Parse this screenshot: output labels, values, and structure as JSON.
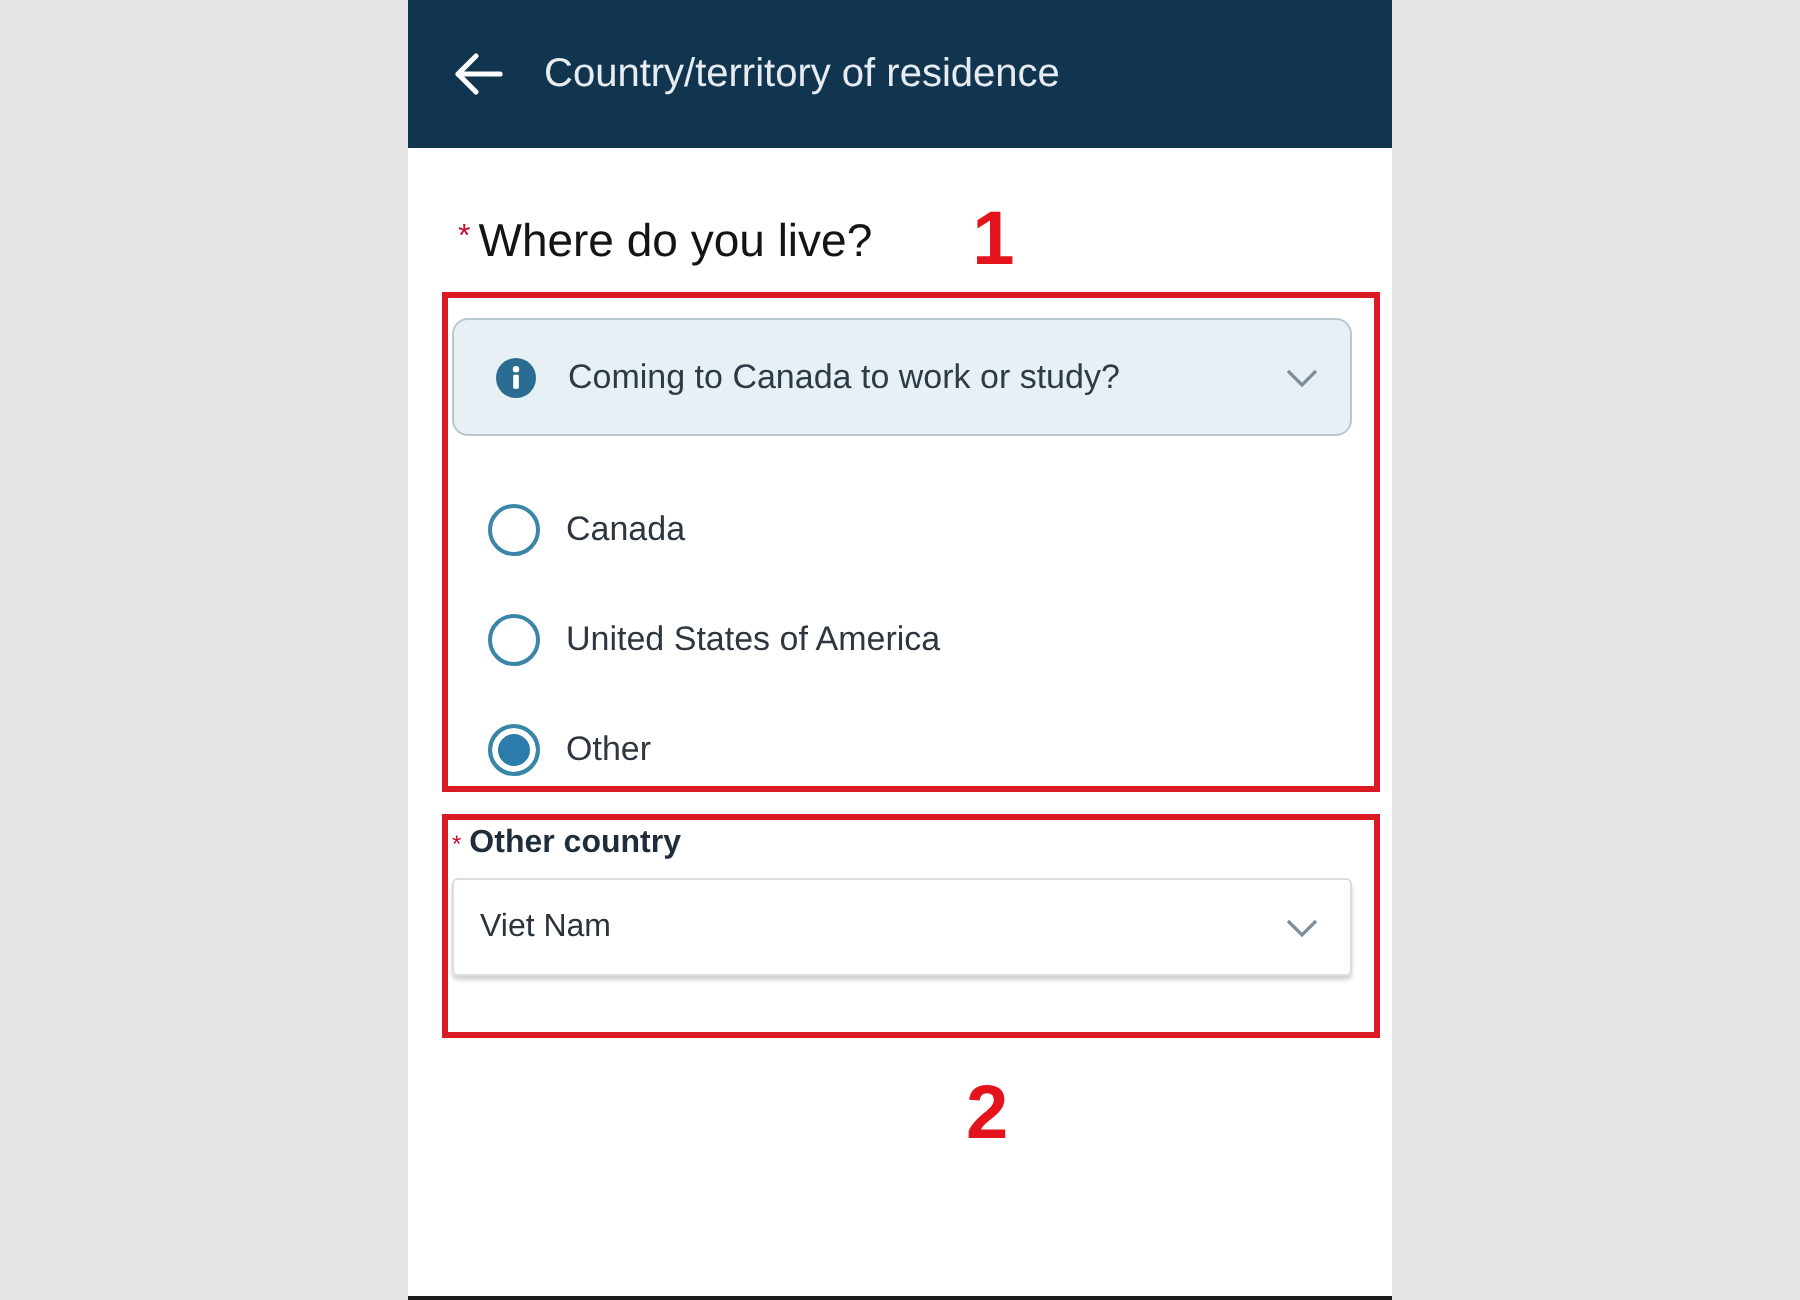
{
  "header": {
    "title": "Country/territory of residence"
  },
  "question": {
    "required_mark": "*",
    "label": "Where do you live?"
  },
  "annotations": [
    {
      "number": "1"
    },
    {
      "number": "2"
    }
  ],
  "info_panel": {
    "text": "Coming to Canada to work or study?",
    "expanded": false
  },
  "options": [
    {
      "label": "Canada",
      "selected": false
    },
    {
      "label": "United States of America",
      "selected": false
    },
    {
      "label": "Other",
      "selected": true
    }
  ],
  "other_country": {
    "required_mark": "*",
    "label": "Other country",
    "value": "Viet Nam"
  }
}
